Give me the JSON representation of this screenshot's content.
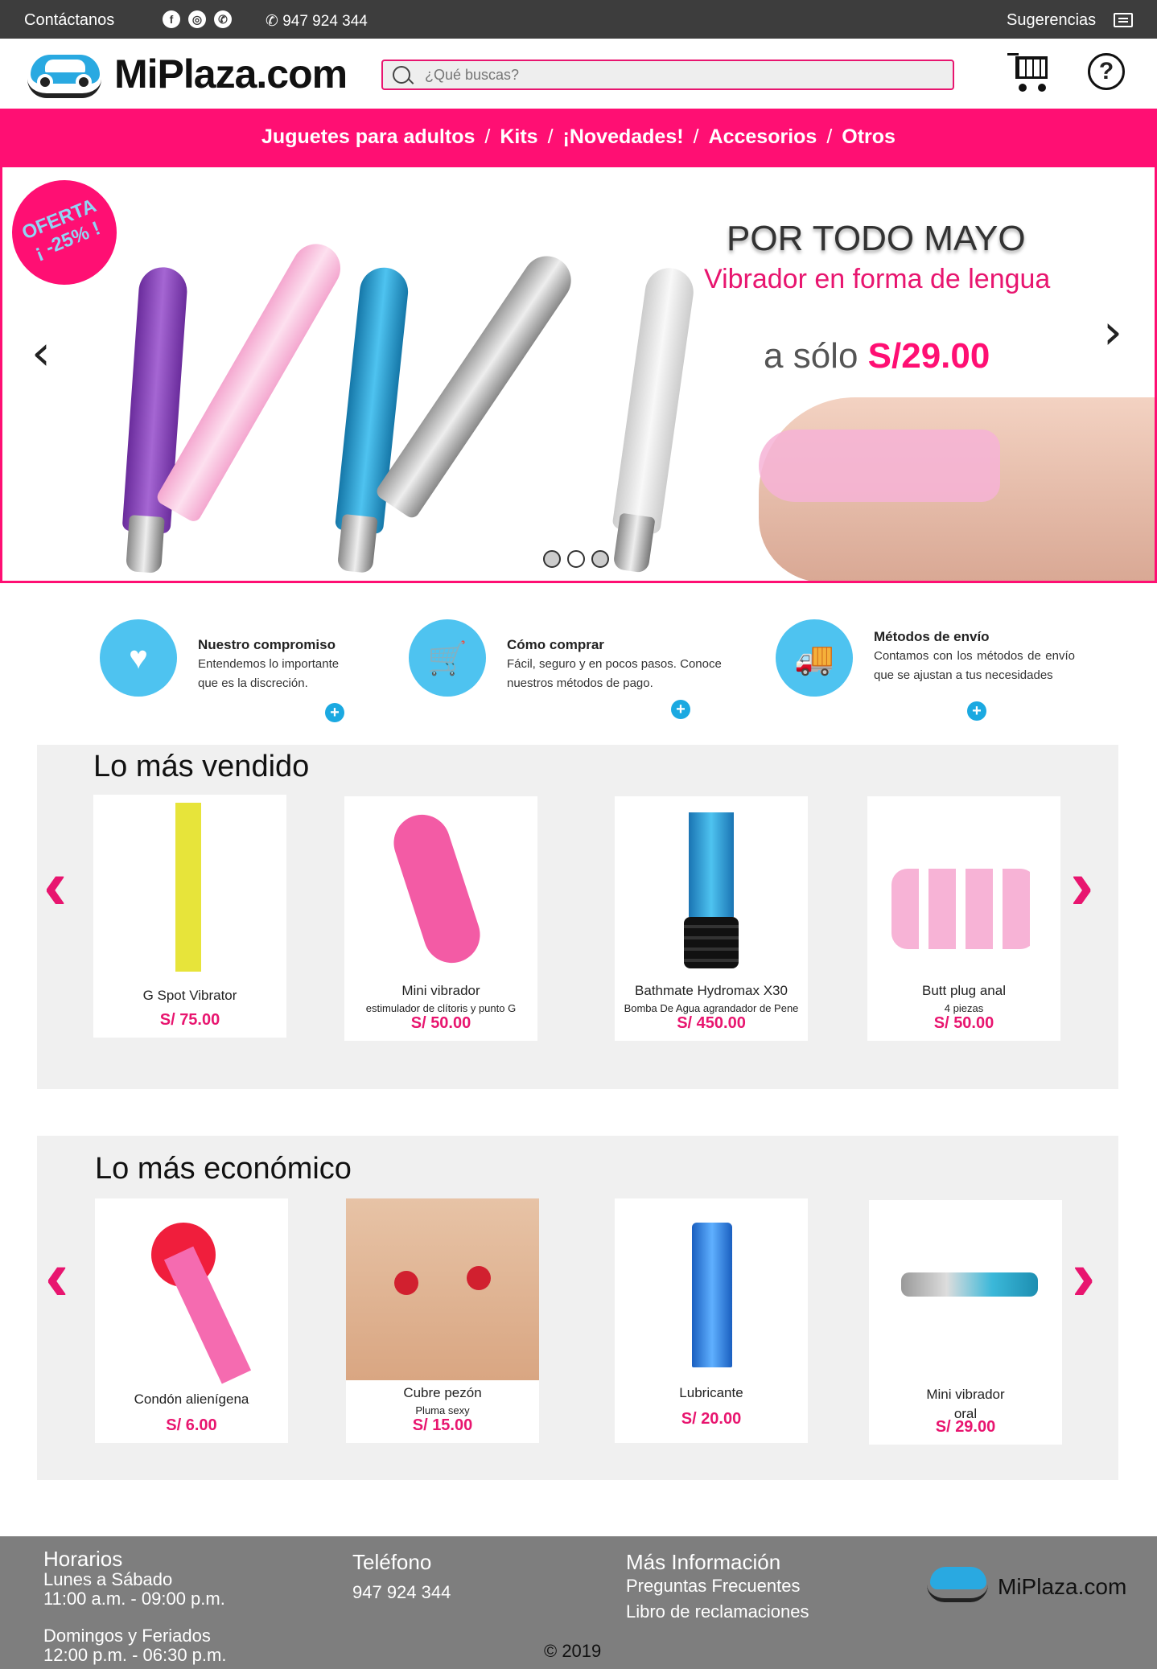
{
  "topbar": {
    "contact": "Contáctanos",
    "phone": "947 924 344",
    "suggestions": "Sugerencias"
  },
  "header": {
    "logo": "MiPlaza.com",
    "search_placeholder": "¿Qué buscas?"
  },
  "nav": {
    "items": [
      "Juguetes para adultos",
      "Kits",
      "¡Novedades!",
      "Accesorios",
      "Otros"
    ]
  },
  "hero": {
    "badge_line1": "OFERTA",
    "badge_line2": "¡ -25% !",
    "title": "POR TODO MAYO",
    "subtitle": "Vibrador en forma de lengua",
    "price_prefix": "a sólo",
    "price": "S/29.00"
  },
  "features": [
    {
      "title": "Nuestro compromiso",
      "text": "Entendemos lo importante que es la discreción."
    },
    {
      "title": "Cómo comprar",
      "text": "Fácil, seguro y en pocos pasos. Conoce nuestros métodos de pago."
    },
    {
      "title": "Métodos de envío",
      "text": "Contamos con los métodos de envío que se ajustan a tus necesidades"
    }
  ],
  "best": {
    "title": "Lo más vendido",
    "products": [
      {
        "name": "G Spot Vibrator",
        "sub": "",
        "price": "S/ 75.00"
      },
      {
        "name": "Mini vibrador",
        "sub": "estimulador de clítoris y punto G",
        "price": "S/ 50.00"
      },
      {
        "name": "Bathmate Hydromax X30",
        "sub": "Bomba De Agua agrandador de Pene",
        "price": "S/ 450.00"
      },
      {
        "name": "Butt plug anal",
        "sub": "4 piezas",
        "price": "S/ 50.00"
      }
    ]
  },
  "cheap": {
    "title": "Lo más económico",
    "products": [
      {
        "name": "Condón alienígena",
        "sub": "",
        "price": "S/ 6.00"
      },
      {
        "name": "Cubre pezón",
        "sub": "Pluma sexy",
        "price": "S/ 15.00"
      },
      {
        "name": "Lubricante",
        "sub": "",
        "price": "S/ 20.00"
      },
      {
        "name": "Mini vibrador",
        "sub": "oral",
        "price": "S/ 29.00"
      }
    ]
  },
  "footer": {
    "hours_title": "Horarios",
    "weekdays": "Lunes a Sábado",
    "weekday_hours": "11:00 a.m. - 09:00 p.m.",
    "weekend": "Domingos y Feriados",
    "weekend_hours": "12:00 p.m. - 06:30 p.m.",
    "phone_title": "Teléfono",
    "phone": "947 924 344",
    "info_title": "Más Información",
    "faq": "Preguntas Frecuentes",
    "claims": "Libro de reclamaciones",
    "logo": "MiPlaza.com",
    "copyright": "© 2019"
  },
  "colors": {
    "accent": "#ff0f73",
    "price": "#e8156f",
    "icon_blue": "#4ec3f0",
    "topbar": "#3d3d3d",
    "footer": "#7e7e7e"
  }
}
